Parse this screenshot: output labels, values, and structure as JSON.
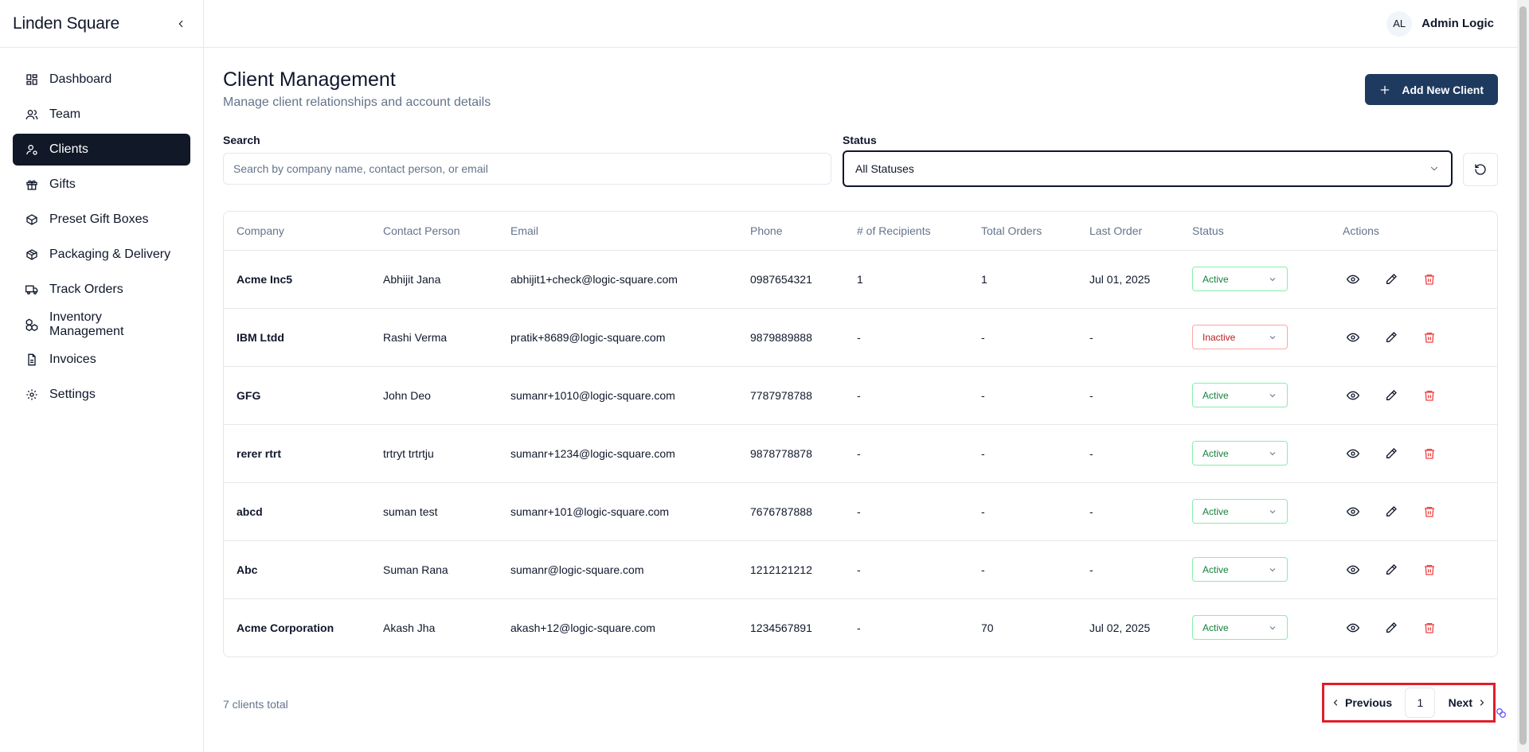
{
  "sidebar": {
    "brand": "Linden Square",
    "items": [
      {
        "label": "Dashboard",
        "icon": "dashboard-icon"
      },
      {
        "label": "Team",
        "icon": "users-icon"
      },
      {
        "label": "Clients",
        "icon": "user-circle-icon",
        "active": true
      },
      {
        "label": "Gifts",
        "icon": "gift-icon"
      },
      {
        "label": "Preset Gift Boxes",
        "icon": "box-icon"
      },
      {
        "label": "Packaging & Delivery",
        "icon": "package-icon"
      },
      {
        "label": "Track Orders",
        "icon": "truck-icon"
      },
      {
        "label": "Inventory Management",
        "icon": "boxes-icon"
      },
      {
        "label": "Invoices",
        "icon": "file-icon"
      },
      {
        "label": "Settings",
        "icon": "gear-icon"
      }
    ]
  },
  "topbar": {
    "avatar_initials": "AL",
    "user_name": "Admin Logic"
  },
  "header": {
    "title": "Client Management",
    "subtitle": "Manage client relationships and account details",
    "add_button": "Add New Client"
  },
  "filters": {
    "search_label": "Search",
    "search_placeholder": "Search by company name, contact person, or email",
    "status_label": "Status",
    "status_value": "All Statuses"
  },
  "table": {
    "columns": [
      "Company",
      "Contact Person",
      "Email",
      "Phone",
      "# of Recipients",
      "Total Orders",
      "Last Order",
      "Status",
      "Actions"
    ],
    "rows": [
      {
        "company": "Acme Inc5",
        "contact": "Abhijit Jana",
        "email": "abhijit1+check@logic-square.com",
        "phone": "0987654321",
        "recipients": "1",
        "orders": "1",
        "last_order": "Jul 01, 2025",
        "status": "Active"
      },
      {
        "company": "IBM Ltdd",
        "contact": "Rashi Verma",
        "email": "pratik+8689@logic-square.com",
        "phone": "9879889888",
        "recipients": "-",
        "orders": "-",
        "last_order": "-",
        "status": "Inactive"
      },
      {
        "company": "GFG",
        "contact": "John Deo",
        "email": "sumanr+1010@logic-square.com",
        "phone": "7787978788",
        "recipients": "-",
        "orders": "-",
        "last_order": "-",
        "status": "Active"
      },
      {
        "company": "rerer rtrt",
        "contact": "trtryt trtrtju",
        "email": "sumanr+1234@logic-square.com",
        "phone": "9878778878",
        "recipients": "-",
        "orders": "-",
        "last_order": "-",
        "status": "Active"
      },
      {
        "company": "abcd",
        "contact": "suman test",
        "email": "sumanr+101@logic-square.com",
        "phone": "7676787888",
        "recipients": "-",
        "orders": "-",
        "last_order": "-",
        "status": "Active"
      },
      {
        "company": "Abc",
        "contact": "Suman Rana",
        "email": "sumanr@logic-square.com",
        "phone": "1212121212",
        "recipients": "-",
        "orders": "-",
        "last_order": "-",
        "status": "Active"
      },
      {
        "company": "Acme Corporation",
        "contact": "Akash Jha",
        "email": "akash+12@logic-square.com",
        "phone": "1234567891",
        "recipients": "-",
        "orders": "70",
        "last_order": "Jul 02, 2025",
        "status": "Active"
      }
    ]
  },
  "footer": {
    "total_text": "7 clients total",
    "prev_label": "Previous",
    "page_number": "1",
    "next_label": "Next"
  },
  "colors": {
    "primary": "#1e3a5f",
    "active_nav": "#111827",
    "active_status": "#15803d",
    "inactive_status": "#b91c1c",
    "delete": "#ef4444",
    "highlight": "#e11d2a"
  }
}
